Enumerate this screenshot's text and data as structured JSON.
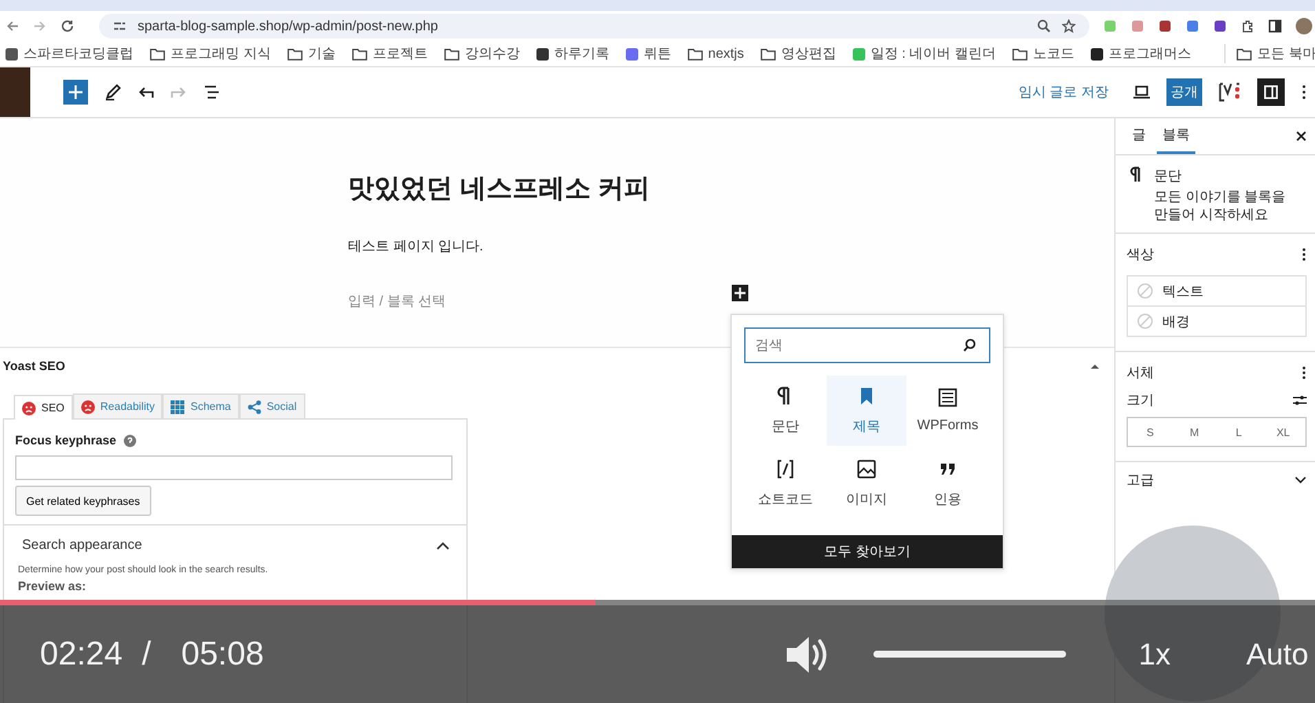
{
  "browser": {
    "url": "sparta-blog-sample.shop/wp-admin/post-new.php",
    "bookmarks": [
      {
        "label": "스파르타코딩클럽",
        "kind": "site"
      },
      {
        "label": "프로그래밍 지식",
        "kind": "folder"
      },
      {
        "label": "기술",
        "kind": "folder"
      },
      {
        "label": "프로젝트",
        "kind": "folder"
      },
      {
        "label": "강의수강",
        "kind": "folder"
      },
      {
        "label": "하루기록",
        "kind": "site"
      },
      {
        "label": "뤼튼",
        "kind": "site"
      },
      {
        "label": "nextjs",
        "kind": "folder"
      },
      {
        "label": "영상편집",
        "kind": "folder"
      },
      {
        "label": "일정 : 네이버 캘린더",
        "kind": "site"
      },
      {
        "label": "노코드",
        "kind": "folder"
      },
      {
        "label": "프로그래머스",
        "kind": "site"
      }
    ],
    "all_bookmarks": "모든 북마"
  },
  "toolbar": {
    "save_draft": "임시 글로 저장",
    "publish": "공개"
  },
  "post": {
    "title": "맛있었던 네스프레소 커피",
    "paragraph": "테스트 페이지 입니다.",
    "placeholder": "입력 / 블록 선택"
  },
  "inserter": {
    "search_placeholder": "검색",
    "browse_all": "모두 찾아보기",
    "blocks": [
      {
        "label": "문단",
        "kind": "paragraph",
        "selected": false
      },
      {
        "label": "제목",
        "kind": "heading",
        "selected": true
      },
      {
        "label": "WPForms",
        "kind": "form",
        "selected": false
      },
      {
        "label": "쇼트코드",
        "kind": "shortcode",
        "selected": false
      },
      {
        "label": "이미지",
        "kind": "image",
        "selected": false
      },
      {
        "label": "인용",
        "kind": "quote",
        "selected": false
      }
    ]
  },
  "sidebar": {
    "tabs": [
      {
        "label": "글",
        "selected": false
      },
      {
        "label": "블록",
        "selected": true
      }
    ],
    "block_name": "문단",
    "block_description": "모든 이야기를 블록을 만들어 시작하세요",
    "color_title": "색상",
    "colors": [
      "텍스트",
      "배경"
    ],
    "typography_title": "서체",
    "size_label": "크기",
    "sizes": [
      "S",
      "M",
      "L",
      "XL"
    ],
    "advanced": "고급"
  },
  "yoast": {
    "title": "Yoast SEO",
    "tabs": [
      {
        "label": "SEO",
        "kind": "score",
        "selected": true
      },
      {
        "label": "Readability",
        "kind": "score",
        "selected": false
      },
      {
        "label": "Schema",
        "kind": "grid",
        "selected": false
      },
      {
        "label": "Social",
        "kind": "share",
        "selected": false
      }
    ],
    "focus_label": "Focus keyphrase",
    "related_button": "Get related keyphrases",
    "search_appearance": "Search appearance",
    "description": "Determine how your post should look in the search results.",
    "preview_label": "Preview as:"
  },
  "player": {
    "progress": {
      "level": 0.453
    },
    "current_time": "02:24",
    "separator": "/",
    "duration": "05:08",
    "volume": {
      "level": 1
    },
    "speed": "1x",
    "quality": "Auto"
  }
}
